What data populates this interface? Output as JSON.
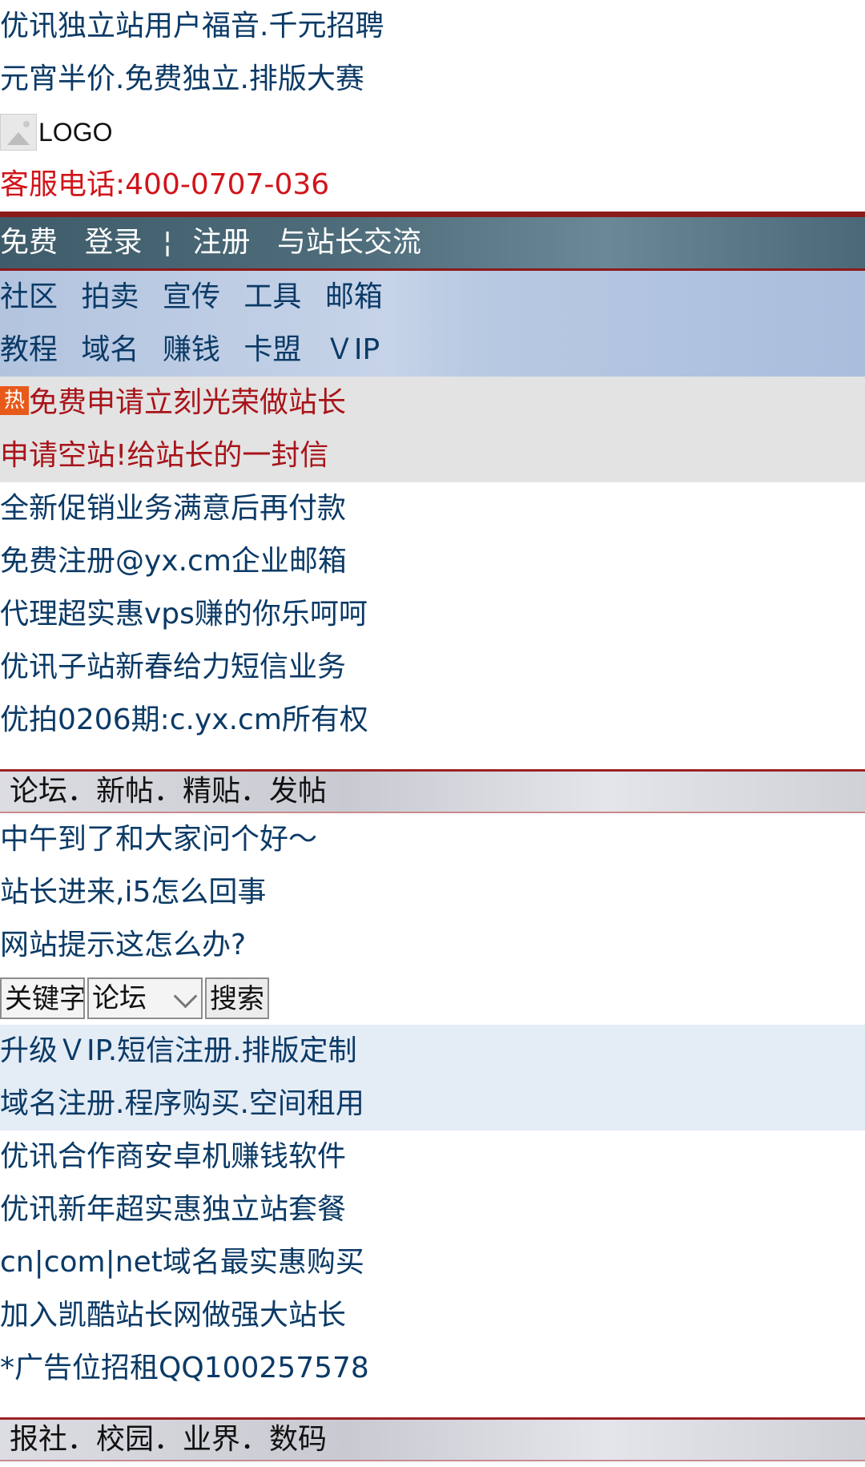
{
  "promo_top": [
    "优讯独立站用户福音.千元招聘",
    "元宵半价.免费独立.排版大赛"
  ],
  "logo": {
    "alt": "LOGO"
  },
  "service_phone": "客服电话:400-0707-036",
  "topbar": {
    "free": "免费",
    "login": "登录",
    "separator": "¦",
    "register": "注册",
    "chat": "与站长交流"
  },
  "nav": {
    "row1": [
      "社区",
      "拍卖",
      "宣传",
      "工具",
      "邮箱"
    ],
    "row2": [
      "教程",
      "域名",
      "赚钱",
      "卡盟",
      "ＶIP"
    ]
  },
  "hot_badge": "热",
  "hot_promos": [
    "免费申请立刻光荣做站长",
    "申请空站!给站长的一封信"
  ],
  "links1": [
    "全新促销业务满意后再付款",
    "免费注册@yx.cm企业邮箱",
    "代理超实惠vps赚的你乐呵呵",
    "优讯子站新春给力短信业务",
    "优拍0206期:c.yx.cm所有权"
  ],
  "forum_header": "论坛．新帖．精贴．发帖",
  "forum_posts": [
    "中午到了和大家问个好～",
    "站长进来,i5怎么回事",
    "网站提示这怎么办?"
  ],
  "search": {
    "keyword_placeholder": "关键字",
    "select_value": "论坛",
    "button": "搜索"
  },
  "services": [
    "升级ＶIP.短信注册.排版定制",
    "域名注册.程序购买.空间租用"
  ],
  "links2": [
    "优讯合作商安卓机赚钱软件",
    "优讯新年超实惠独立站套餐",
    "cn|com|net域名最实惠购买",
    "加入凯酷站长网做强大站长",
    "*广告位招租QQ100257578"
  ],
  "bottom_header": "报社．校园．业界．数码",
  "colors": {
    "brand_red": "#8b1a1a",
    "link": "#0b3a66",
    "hot": "#d0141a"
  }
}
